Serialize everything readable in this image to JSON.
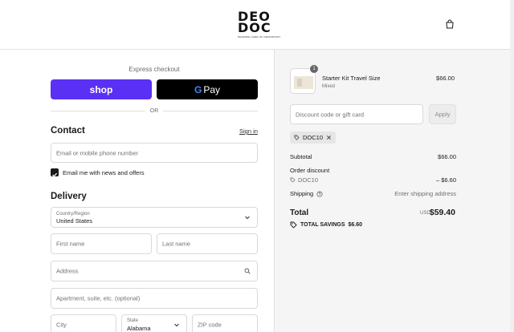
{
  "header": {
    "logo_line1": "DEO",
    "logo_line2": "DOC",
    "logo_tagline": "DEFENSE CARE OF DEODORANT"
  },
  "checkout": {
    "express_label": "Express checkout",
    "shop_label": "shop",
    "gpay_g": "G",
    "gpay_label": "Pay",
    "or_label": "OR"
  },
  "contact": {
    "heading": "Contact",
    "signin_label": "Sign in",
    "email_placeholder": "Email or mobile phone number",
    "news_label": "Email me with news and offers",
    "news_checked": true
  },
  "delivery": {
    "heading": "Delivery",
    "country_label": "Country/Region",
    "country_value": "United States",
    "first_name_placeholder": "First name",
    "last_name_placeholder": "Last name",
    "address_placeholder": "Address",
    "apartment_placeholder": "Apartment, suite, etc. (optional)",
    "city_placeholder": "City",
    "state_label": "State",
    "state_value": "Alabama",
    "zip_placeholder": "ZIP code"
  },
  "summary": {
    "item": {
      "quantity": "1",
      "name": "Starter Kit Travel Size",
      "variant": "Mixed",
      "price": "$66.00"
    },
    "discount_placeholder": "Discount code or gift card",
    "apply_label": "Apply",
    "applied_code": "DOC10",
    "subtotal_label": "Subtotal",
    "subtotal_value": "$66.00",
    "order_discount_label": "Order discount",
    "discount_code": "DOC10",
    "discount_value": "– $6.60",
    "shipping_label": "Shipping",
    "shipping_value": "Enter shipping address",
    "total_label": "Total",
    "currency": "USD",
    "total_value": "$59.40",
    "savings_label": "TOTAL SAVINGS",
    "savings_value": "$6.60"
  },
  "colors": {
    "shop_purple": "#5a31f4",
    "summary_bg": "#f5f5f5"
  }
}
